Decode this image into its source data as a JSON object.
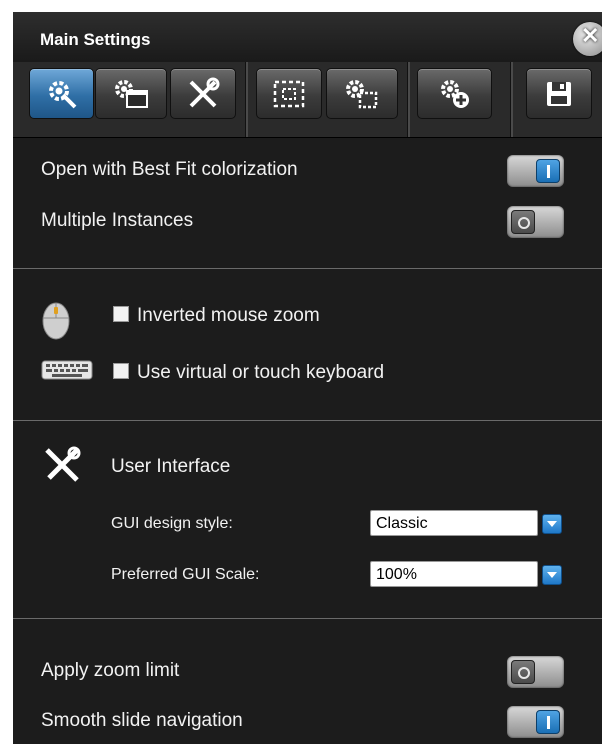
{
  "window": {
    "title": "Main Settings",
    "close_glyph": "✕"
  },
  "toolbar": {
    "buttons": [
      {
        "icon": "general-settings-icon",
        "active": true
      },
      {
        "icon": "display-settings-icon",
        "active": false
      },
      {
        "icon": "tools-icon",
        "active": false
      },
      {
        "icon": "selection-icon",
        "active": false
      },
      {
        "icon": "region-settings-icon",
        "active": false
      },
      {
        "icon": "add-settings-icon",
        "active": false
      },
      {
        "icon": "save-icon",
        "active": false
      }
    ],
    "active_color": "#2f6fa6"
  },
  "general": {
    "best_fit": {
      "label": "Open with Best Fit colorization",
      "on": true
    },
    "multiple_instances": {
      "label": "Multiple Instances",
      "on": false
    }
  },
  "input": {
    "mouse_icon": "mouse-icon",
    "keyboard_icon": "keyboard-icon",
    "inverted_zoom": {
      "label": "Inverted mouse zoom",
      "checked": false
    },
    "virtual_keyboard": {
      "label": "Use virtual or touch keyboard",
      "checked": false
    }
  },
  "ui": {
    "icon": "tools-icon",
    "heading": "User Interface",
    "design_style": {
      "label": "GUI design style:",
      "value": "Classic"
    },
    "gui_scale": {
      "label": "Preferred GUI Scale:",
      "value": "100%"
    }
  },
  "navigation": {
    "zoom_limit": {
      "label": "Apply zoom limit",
      "on": false
    },
    "smooth_slide": {
      "label": "Smooth slide navigation",
      "on": true
    }
  }
}
